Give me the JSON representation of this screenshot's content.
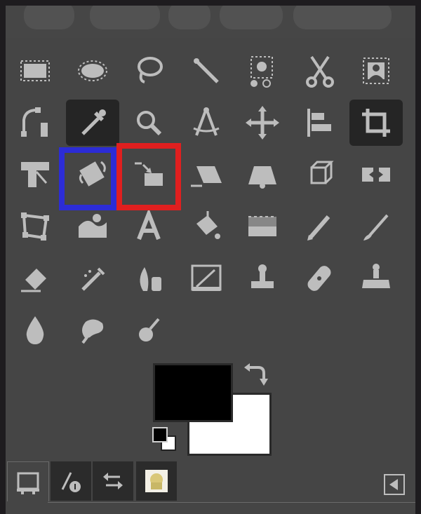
{
  "panel": {
    "name": "Toolbox",
    "background": "#454545",
    "icon_color": "#bdbdbd"
  },
  "tools": [
    {
      "id": "rect-select",
      "icon": "rectangle-select-icon",
      "active": false
    },
    {
      "id": "ellipse-select",
      "icon": "ellipse-select-icon",
      "active": false
    },
    {
      "id": "free-select",
      "icon": "lasso-icon",
      "active": false
    },
    {
      "id": "fuzzy-select",
      "icon": "magic-wand-icon",
      "active": false
    },
    {
      "id": "select-by-color",
      "icon": "select-by-color-icon",
      "active": false
    },
    {
      "id": "scissors-select",
      "icon": "scissors-icon",
      "active": false
    },
    {
      "id": "foreground-select",
      "icon": "foreground-select-icon",
      "active": false
    },
    {
      "id": "paths",
      "icon": "paths-icon",
      "active": false
    },
    {
      "id": "color-picker",
      "icon": "eyedropper-icon",
      "active": true
    },
    {
      "id": "zoom",
      "icon": "magnifier-icon",
      "active": false
    },
    {
      "id": "measure",
      "icon": "compass-icon",
      "active": false
    },
    {
      "id": "move",
      "icon": "move-arrows-icon",
      "active": false
    },
    {
      "id": "align",
      "icon": "align-icon",
      "active": false
    },
    {
      "id": "crop",
      "icon": "crop-icon",
      "active": true
    },
    {
      "id": "unified-transform",
      "icon": "unified-transform-icon",
      "active": false
    },
    {
      "id": "rotate",
      "icon": "rotate-icon",
      "active": false
    },
    {
      "id": "scale",
      "icon": "scale-icon",
      "active": false
    },
    {
      "id": "shear",
      "icon": "shear-icon",
      "active": false
    },
    {
      "id": "perspective",
      "icon": "perspective-icon",
      "active": false
    },
    {
      "id": "3d-transform",
      "icon": "cube-icon",
      "active": false
    },
    {
      "id": "flip",
      "icon": "flip-icon",
      "active": false
    },
    {
      "id": "cage-transform",
      "icon": "cage-icon",
      "active": false
    },
    {
      "id": "warp-transform",
      "icon": "warp-icon",
      "active": false
    },
    {
      "id": "text",
      "icon": "text-icon",
      "active": false
    },
    {
      "id": "bucket-fill",
      "icon": "bucket-fill-icon",
      "active": false
    },
    {
      "id": "blend",
      "icon": "gradient-icon",
      "active": false
    },
    {
      "id": "pencil",
      "icon": "pencil-icon",
      "active": false
    },
    {
      "id": "paintbrush",
      "icon": "paintbrush-icon",
      "active": false
    },
    {
      "id": "eraser",
      "icon": "eraser-icon",
      "active": false
    },
    {
      "id": "airbrush",
      "icon": "airbrush-icon",
      "active": false
    },
    {
      "id": "ink",
      "icon": "ink-icon",
      "active": false
    },
    {
      "id": "mypaint-brush",
      "icon": "mypaint-brush-icon",
      "active": false
    },
    {
      "id": "clone",
      "icon": "clone-stamp-icon",
      "active": false
    },
    {
      "id": "heal",
      "icon": "heal-bandage-icon",
      "active": false
    },
    {
      "id": "perspective-clone",
      "icon": "perspective-clone-icon",
      "active": false
    },
    {
      "id": "blur-sharpen",
      "icon": "water-drop-icon",
      "active": false
    },
    {
      "id": "smudge",
      "icon": "smudge-icon",
      "active": false
    },
    {
      "id": "dodge-burn",
      "icon": "dodge-burn-icon",
      "active": false
    }
  ],
  "highlights": [
    {
      "target": "rotate",
      "color": "#2c2cd6"
    },
    {
      "target": "scale",
      "color": "#e01f1f"
    }
  ],
  "colors": {
    "foreground": "#000000",
    "background": "#ffffff",
    "swap_icon": "swap-colors-icon",
    "reset_icon": "default-colors-icon"
  },
  "tabs": [
    {
      "id": "tool-options",
      "icon": "tool-options-icon",
      "selected": true
    },
    {
      "id": "device-status",
      "icon": "device-status-icon",
      "selected": false
    },
    {
      "id": "undo-history",
      "icon": "undo-history-icon",
      "selected": false
    },
    {
      "id": "images",
      "icon": "image-thumbnail-icon",
      "selected": false
    }
  ],
  "tab_menu_icon": "tab-menu-icon"
}
